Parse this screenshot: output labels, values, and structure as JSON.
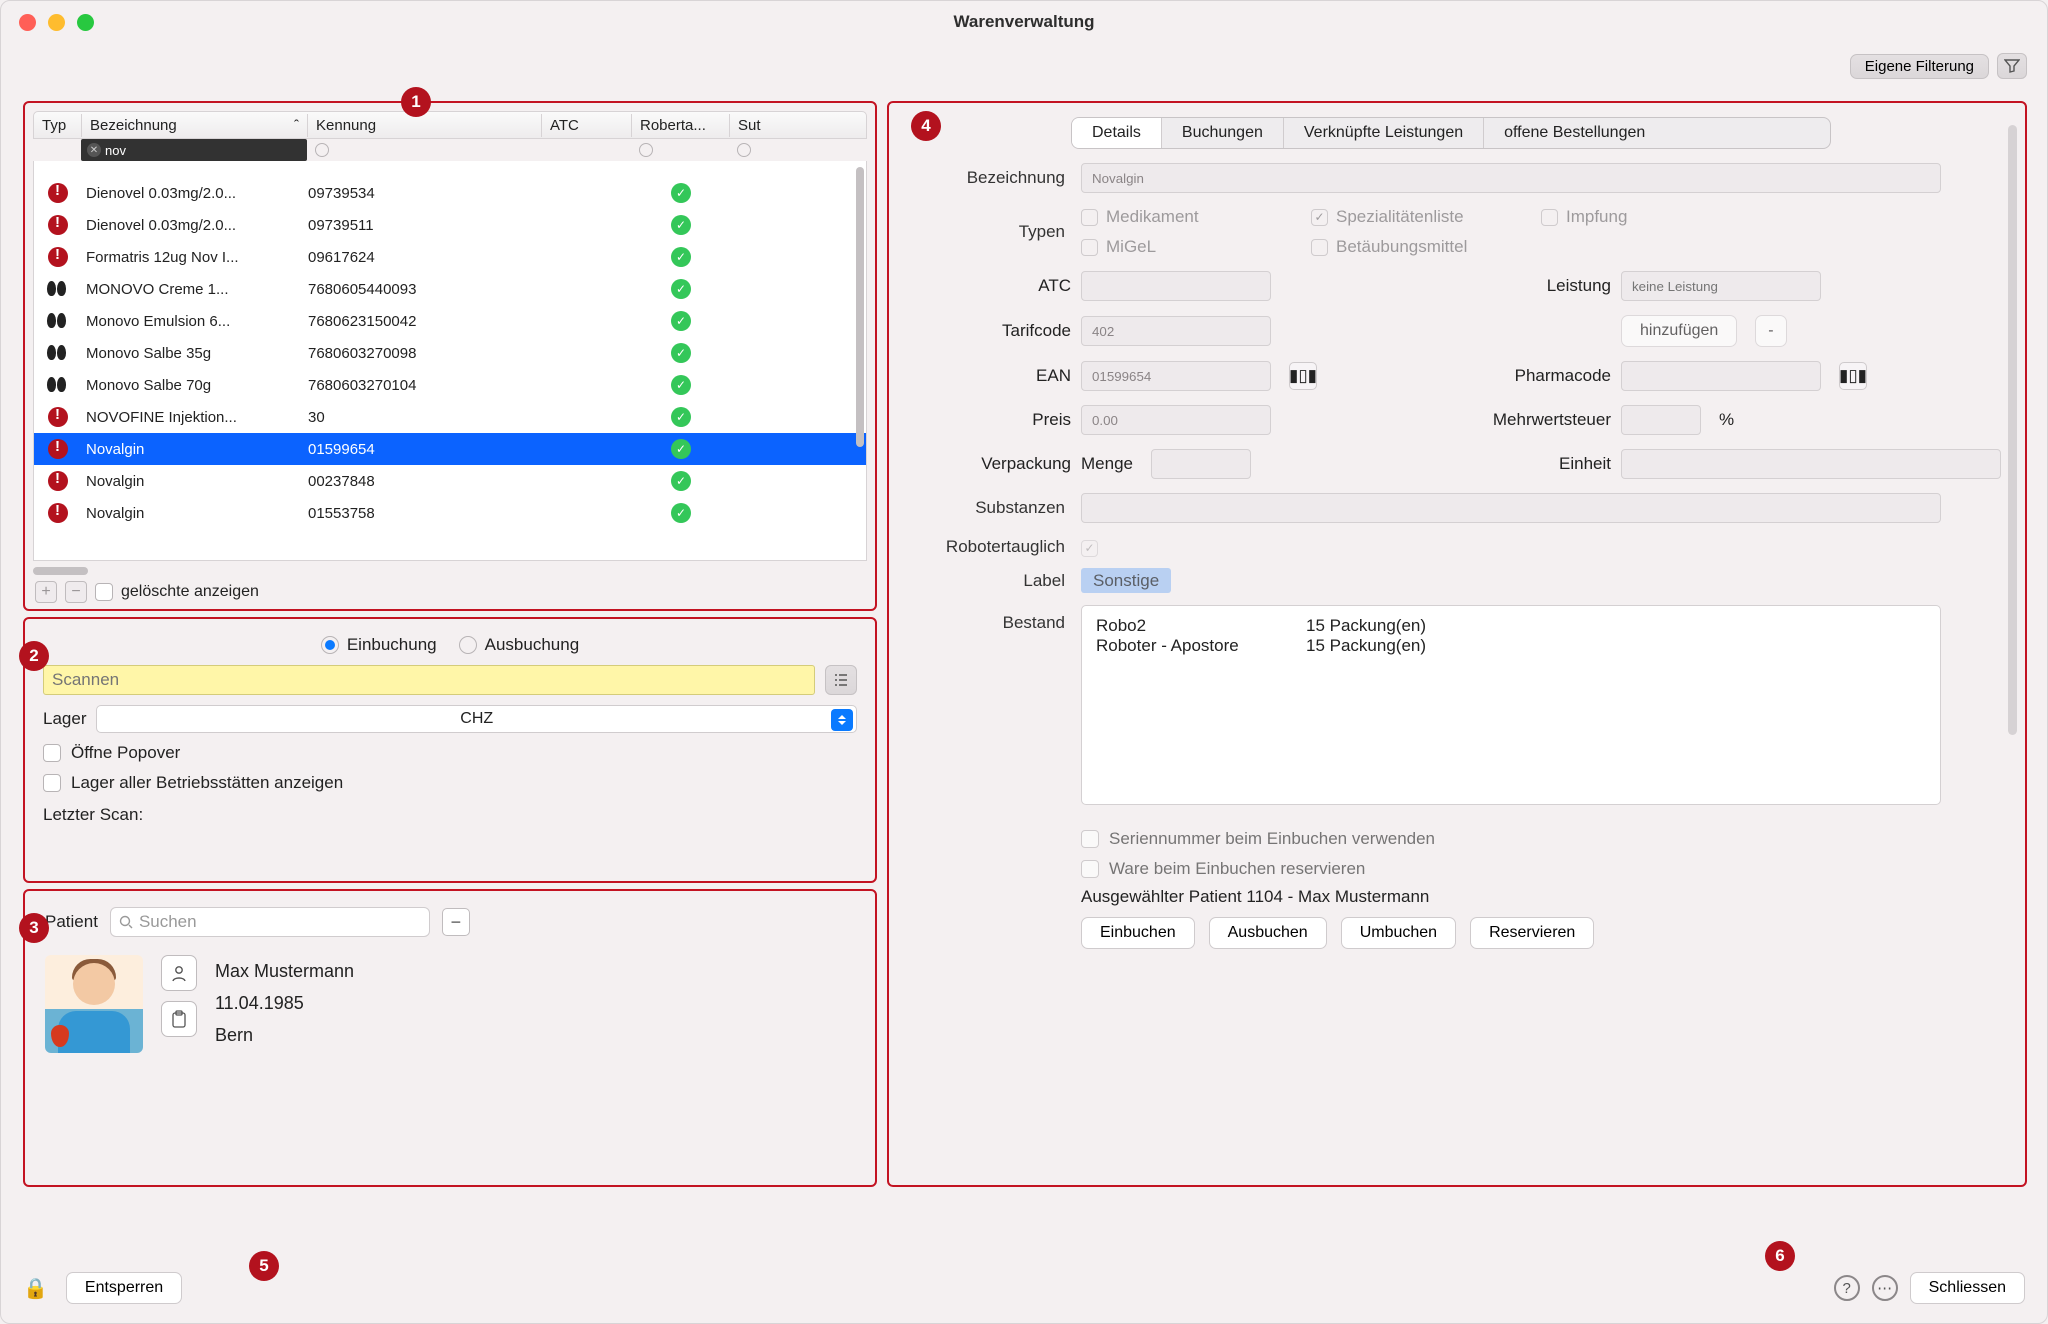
{
  "window": {
    "title": "Warenverwaltung"
  },
  "toolbar": {
    "filter_label": "Eigene Filterung"
  },
  "callouts": {
    "c1": "1",
    "c2": "2",
    "c3": "3",
    "c4": "4",
    "c5": "5",
    "c6": "6"
  },
  "grid": {
    "cols": {
      "typ": "Typ",
      "bez": "Bezeichnung",
      "ken": "Kennung",
      "atc": "ATC",
      "rob": "Roberta...",
      "sut": "Sut"
    },
    "filter_bez": "nov",
    "rows": [
      {
        "typ": "warn",
        "bez": "Dienovel 0.03mg/2.0...",
        "ken": "09739534",
        "rob": true
      },
      {
        "typ": "warn",
        "bez": "Dienovel 0.03mg/2.0...",
        "ken": "09739511",
        "rob": true
      },
      {
        "typ": "warn",
        "bez": "Formatris 12ug Nov I...",
        "ken": "09617624",
        "rob": true
      },
      {
        "typ": "hp",
        "bez": "MONOVO Creme 1...",
        "ken": "7680605440093",
        "rob": true
      },
      {
        "typ": "hp",
        "bez": "Monovo Emulsion 6...",
        "ken": "7680623150042",
        "rob": true
      },
      {
        "typ": "hp",
        "bez": "Monovo Salbe 35g",
        "ken": "7680603270098",
        "rob": true
      },
      {
        "typ": "hp",
        "bez": "Monovo Salbe 70g",
        "ken": "7680603270104",
        "rob": true
      },
      {
        "typ": "warn",
        "bez": "NOVOFINE Injektion...",
        "ken": "30",
        "rob": true
      },
      {
        "typ": "warn",
        "bez": "Novalgin",
        "ken": "01599654",
        "rob": true,
        "sel": true
      },
      {
        "typ": "warn",
        "bez": "Novalgin",
        "ken": "00237848",
        "rob": true
      },
      {
        "typ": "warn",
        "bez": "Novalgin",
        "ken": "01553758",
        "rob": true
      }
    ],
    "show_deleted": "gelöschte anzeigen"
  },
  "scan": {
    "einbuchung": "Einbuchung",
    "ausbuchung": "Ausbuchung",
    "placeholder": "Scannen",
    "lager_label": "Lager",
    "lager_value": "CHZ",
    "popover": "Öffne Popover",
    "alle_lager": "Lager aller Betriebsstätten anzeigen",
    "last_scan": "Letzter Scan:"
  },
  "patient": {
    "label": "Patient",
    "search_ph": "Suchen",
    "name": "Max Mustermann",
    "dob": "11.04.1985",
    "city": "Bern"
  },
  "detail": {
    "tabs": {
      "details": "Details",
      "buchungen": "Buchungen",
      "leistungen": "Verknüpfte Leistungen",
      "offene": "offene Bestellungen"
    },
    "bez_label": "Bezeichnung",
    "bez_value": "Novalgin",
    "typen_label": "Typen",
    "types": {
      "medikament": "Medikament",
      "spez": "Spezialitätenliste",
      "impfung": "Impfung",
      "migel": "MiGeL",
      "btm": "Betäubungsmittel"
    },
    "atc_label": "ATC",
    "leistung_label": "Leistung",
    "leistung_ph": "keine Leistung",
    "tarif_label": "Tarifcode",
    "tarif_value": "402",
    "hinzu": "hinzufügen",
    "minus": "-",
    "ean_label": "EAN",
    "ean_value": "01599654",
    "pharma_label": "Pharmacode",
    "preis_label": "Preis",
    "preis_value": "0.00",
    "mwst_label": "Mehrwertsteuer",
    "mwst_unit": "%",
    "verp_label": "Verpackung",
    "menge": "Menge",
    "einheit": "Einheit",
    "subst_label": "Substanzen",
    "robot_label": "Robotertauglich",
    "label_label": "Label",
    "label_value": "Sonstige",
    "bestand_label": "Bestand",
    "stock": [
      {
        "loc": "Robo2",
        "qty": "15 Packung(en)"
      },
      {
        "loc": "Roboter - Apostore",
        "qty": "15 Packung(en)"
      }
    ],
    "serien": "Seriennummer beim Einbuchen verwenden",
    "reserv_ein": "Ware beim Einbuchen reservieren",
    "sel_patient": "Ausgewählter Patient 1104 - Max Mustermann",
    "btn_ein": "Einbuchen",
    "btn_aus": "Ausbuchen",
    "btn_um": "Umbuchen",
    "btn_res": "Reservieren"
  },
  "footer": {
    "unlock": "Entsperren",
    "close": "Schliessen"
  }
}
